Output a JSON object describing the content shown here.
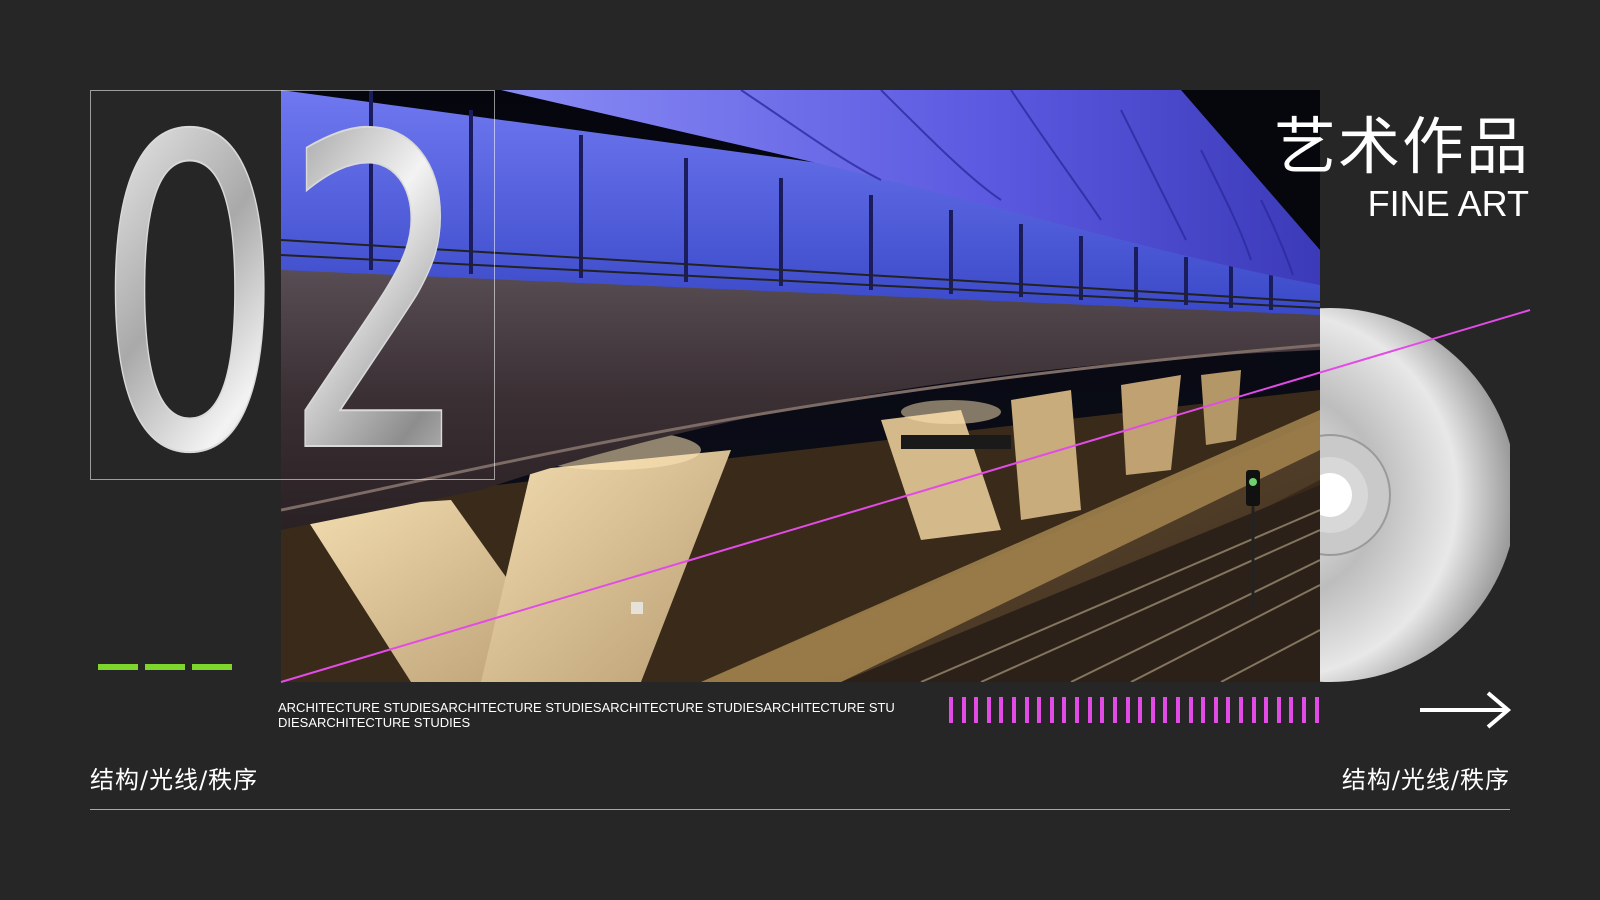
{
  "slide": {
    "number": "02",
    "title_cn": "艺术作品",
    "title_en": "FINE ART",
    "tagline": "ARCHITECTURE STUDIESARCHITECTURE STUDIESARCHITECTURE STUDIESARCHITECTURE STUDIESARCHITECTURE STUDIES",
    "caption_left": "结构/光线/秩序",
    "caption_right": "结构/光线/秩序"
  },
  "icons": {
    "arrow": "arrow-right-icon",
    "disc": "cd-disc-icon"
  },
  "colors": {
    "background": "#262626",
    "accent_green": "#7ed62d",
    "accent_pink": "#e24be6",
    "text": "#ffffff"
  }
}
